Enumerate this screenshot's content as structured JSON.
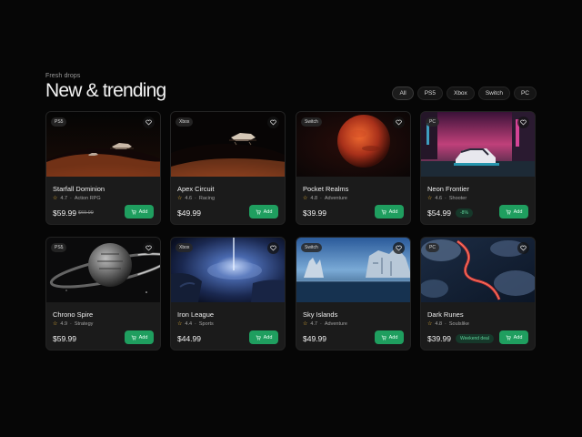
{
  "header": {
    "eyebrow": "Fresh drops",
    "title": "New & trending"
  },
  "filters": [
    {
      "label": "All",
      "active": true
    },
    {
      "label": "PS5",
      "active": false
    },
    {
      "label": "Xbox",
      "active": false
    },
    {
      "label": "Switch",
      "active": false
    },
    {
      "label": "PC",
      "active": false
    }
  ],
  "cards": [
    {
      "platform": "PS5",
      "name": "Starfall Dominion",
      "rating": "4.7",
      "genre": "Action RPG",
      "price": "$59.99",
      "old_price": "$69.99",
      "badge": "",
      "add_label": "Add"
    },
    {
      "platform": "Xbox",
      "name": "Apex Circuit",
      "rating": "4.6",
      "genre": "Racing",
      "price": "$49.99",
      "old_price": "",
      "badge": "",
      "add_label": "Add"
    },
    {
      "platform": "Switch",
      "name": "Pocket Realms",
      "rating": "4.8",
      "genre": "Adventure",
      "price": "$39.99",
      "old_price": "",
      "badge": "",
      "add_label": "Add"
    },
    {
      "platform": "PC",
      "name": "Neon Frontier",
      "rating": "4.6",
      "genre": "Shooter",
      "price": "$54.99",
      "old_price": "",
      "badge": "-8%",
      "add_label": "Add"
    },
    {
      "platform": "PS5",
      "name": "Chrono Spire",
      "rating": "4.9",
      "genre": "Strategy",
      "price": "$59.99",
      "old_price": "",
      "badge": "",
      "add_label": "Add"
    },
    {
      "platform": "Xbox",
      "name": "Iron League",
      "rating": "4.4",
      "genre": "Sports",
      "price": "$44.99",
      "old_price": "",
      "badge": "",
      "add_label": "Add"
    },
    {
      "platform": "Switch",
      "name": "Sky Islands",
      "rating": "4.7",
      "genre": "Adventure",
      "price": "$49.99",
      "old_price": "",
      "badge": "",
      "add_label": "Add"
    },
    {
      "platform": "PC",
      "name": "Dark Runes",
      "rating": "4.8",
      "genre": "Soulslike",
      "price": "$39.99",
      "old_price": "",
      "badge": "Weekend deal",
      "add_label": "Add"
    }
  ],
  "icons": {
    "favorite": "heart-icon",
    "rating": "star-icon",
    "cart": "cart-icon"
  },
  "colors": {
    "accent": "#1f9e5f",
    "star": "#f1b93a",
    "background": "#060606",
    "card": "#1b1b1b"
  }
}
